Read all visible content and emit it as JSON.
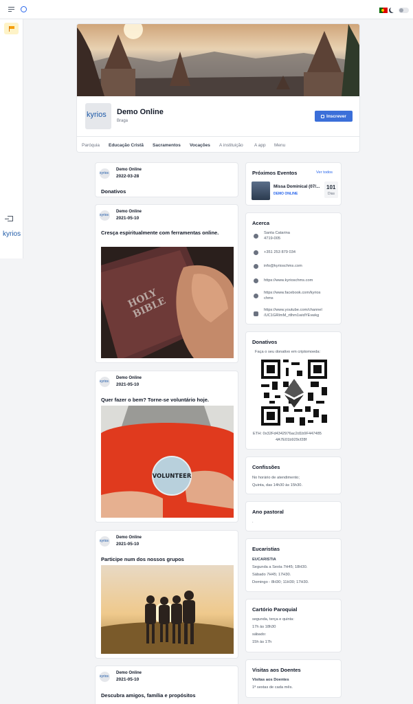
{
  "app": {
    "accent": "#3b6fd9",
    "brand_logo": "kyrios"
  },
  "topbar": {
    "menu_icon": "hamburger-icon",
    "logo_icon": "ring-icon",
    "language": "portugal-flag",
    "theme_icon": "moon-icon"
  },
  "sidebar": {
    "active_icon": "flag-icon",
    "login_icon": "login-icon",
    "logo_text": "kyrios"
  },
  "profile": {
    "name": "Demo Online",
    "location": "Braga",
    "subscribe_label": "Inscrever",
    "logo_text": "kyrios",
    "tabs": [
      {
        "label": "Paróquia"
      },
      {
        "label": "Educação Cristã"
      },
      {
        "label": "Sacramentos"
      },
      {
        "label": "Vocações"
      },
      {
        "label": "A instituição"
      },
      {
        "label": "A app"
      },
      {
        "label": "Menu"
      }
    ]
  },
  "posts": [
    {
      "author": "Demo Online",
      "date": "2022-03-28",
      "title": "Donativos"
    },
    {
      "author": "Demo Online",
      "date": "2021-05-10",
      "title": "Cresça espiritualmente com ferramentas online.",
      "image": "holy-bible-image"
    },
    {
      "author": "Demo Online",
      "date": "2021-05-10",
      "title": "Quer fazer o bem? Torne-se voluntário hoje.",
      "image": "volunteer-badge-image"
    },
    {
      "author": "Demo Online",
      "date": "2021-05-10",
      "title": "Participe num dos nossos grupos",
      "image": "group-sunset-image"
    },
    {
      "author": "Demo Online",
      "date": "2021-05-10",
      "title": "Descubra amigos, família e propósitos"
    }
  ],
  "post_logo_text": "kyrios",
  "events": {
    "title": "Próximos Eventos",
    "see_all": "Ver todos",
    "item": {
      "title": "Missa Dominical (07/...",
      "tag": "DEMO ONLINE",
      "days": "101",
      "days_label": "Dias"
    }
  },
  "about": {
    "title": "Acerca",
    "address_lines": [
      "Santa Catarina",
      "4719-005"
    ],
    "phone": "+351 253 879 034",
    "email": "info@kyrioschms.com",
    "website": "https://www.kyrioschms.com",
    "facebook_lines": [
      "https://www.facebook.com/kyrios",
      "chms"
    ],
    "youtube_lines": [
      "https://www.youtube.com/channel",
      "/UC1GRlmM_rtlhm1widYEvwkg"
    ]
  },
  "donations": {
    "title": "Donativos",
    "subtitle": "Faça o seu donativo em criptomoeda:",
    "eth_lines": [
      "ETH: 0x32Fd4342976ac2d1b9F447485",
      "4A7E01b929cf28f"
    ]
  },
  "confessions": {
    "title": "Confissões",
    "lines": [
      "No horário de atendimento;",
      "Quinta, das 14h30 às 15h30."
    ]
  },
  "pastoral": {
    "title": "Ano pastoral",
    "text": "."
  },
  "eucharist": {
    "title": "Eucaristias",
    "heading": "EUCARISTIA",
    "lines": [
      "Segunda a Sexta 7H45; 18H30.",
      "Sábado 7H45; 17H30.",
      "Domingo - 8H30; 11H30; 17H30."
    ]
  },
  "registry": {
    "title": "Cartório Paroquial",
    "lines": [
      "segunda, terça e quinta:",
      "17h às 18h30",
      "sábado:",
      "15h às 17h"
    ]
  },
  "visits": {
    "title": "Visitas aos Doentes",
    "heading": "Visitas aos Doentes",
    "text": "1ª sextas de cada mês."
  }
}
